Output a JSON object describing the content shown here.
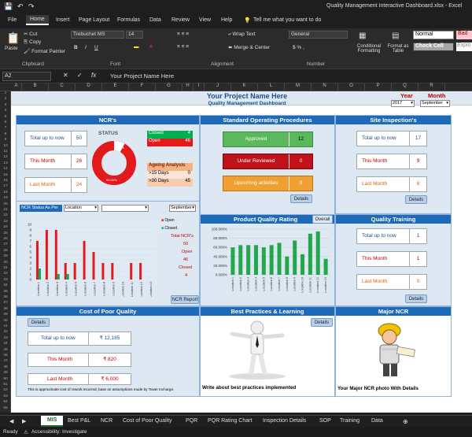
{
  "window": {
    "title": "Quality Management Interactive Dashboard.xlsx - Excel"
  },
  "menu": {
    "file": "File",
    "tabs": [
      "Home",
      "Insert",
      "Page Layout",
      "Formulas",
      "Data",
      "Review",
      "View",
      "Help"
    ],
    "tellme": "Tell me what you want to do"
  },
  "ribbon": {
    "clipboard": {
      "paste": "Paste",
      "cut": "Cut",
      "copy": "Copy",
      "painter": "Format Painter",
      "group": "Clipboard"
    },
    "font": {
      "family": "Trebuchet MS",
      "size": "14",
      "group": "Font"
    },
    "alignment": {
      "wrap": "Wrap Text",
      "merge": "Merge & Center",
      "group": "Alignment"
    },
    "number": {
      "format": "General",
      "group": "Number"
    },
    "styles": {
      "conditional": "Conditional Formatting",
      "table": "Format as Table",
      "normal": "Normal",
      "bad": "Bad",
      "check": "Check Cell",
      "expl": "Explo"
    }
  },
  "formula": {
    "namebox": "A2",
    "fx": "fx",
    "value": "Your Project Name Here"
  },
  "columns": [
    "A",
    "B",
    "C",
    "D",
    "E",
    "F",
    "G",
    "H",
    "I",
    "J",
    "K",
    "L",
    "M",
    "N",
    "O",
    "P",
    "Q",
    "R"
  ],
  "rows": [
    "1",
    "2",
    "3",
    "4",
    "5",
    "6",
    "7",
    "8",
    "9",
    "10",
    "11",
    "12",
    "13",
    "14",
    "15",
    "16",
    "17",
    "18",
    "19",
    "20",
    "21",
    "22",
    "23",
    "24",
    "25",
    "26",
    "27",
    "28",
    "29",
    "30",
    "31",
    "32",
    "33",
    "34",
    "35",
    "36",
    "37",
    "38",
    "39",
    "40",
    "41",
    "42",
    "43",
    "44",
    "45",
    "46",
    "47",
    "48",
    "49",
    "50",
    "51",
    "52",
    "53",
    "54",
    "55"
  ],
  "sheet": {
    "project": "Your Project Name Here",
    "subtitle": "Quality Management Dashboard",
    "year_label": "Year",
    "month_label": "Month",
    "year": "2017",
    "month": "September"
  },
  "ncr": {
    "title": "NCR's",
    "total_label": "Total up to now",
    "total": "50",
    "month_label": "This Month",
    "month": "26",
    "last_label": "Last Month",
    "last": "24",
    "status_title": "STATUS",
    "closed_label": "Closed",
    "closed": "4",
    "open_label": "Open",
    "open": "46",
    "donut_closed_pct": "8%",
    "donut_open_pct": "92,00%",
    "ageing_title": "Ageing Analysis",
    "gt15_label": ">15 Days",
    "gt15": "0",
    "gt30_label": ">30 Days",
    "gt30": "45",
    "filter_label": "NCR Status As Per",
    "filter_value": "Location",
    "filter2": "",
    "filter3": "September",
    "legend_open": "Open",
    "legend_closed": "Closed",
    "total_ncrs_label": "Total NCR's",
    "total_ncrs": "50",
    "open2_label": "Open",
    "open2": "46",
    "closed2_label": "Closed",
    "closed2": "4",
    "report_btn": "NCR Report"
  },
  "sop": {
    "title": "Standard Operating Procedures",
    "approved_label": "Approved",
    "approved": "12",
    "review_label": "Under Reviewed",
    "review": "0",
    "upcoming_label": "Upcoming activities",
    "upcoming": "0",
    "details": "Details"
  },
  "site": {
    "title": "Site Inspection's",
    "total_label": "Total up to now",
    "total": "17",
    "month_label": "This Month",
    "month": "9",
    "last_label": "Last Month",
    "last": "8",
    "details": "Details"
  },
  "pqr": {
    "title": "Product Quality Rating",
    "overall": "Overall"
  },
  "training": {
    "title": "Quality Training",
    "total_label": "Total up to now",
    "total": "1",
    "month_label": "This Month",
    "month": "1",
    "last_label": "Last Month",
    "last": "0",
    "details": "Details"
  },
  "copq": {
    "title": "Cost of Poor Quality",
    "details": "Details",
    "total_label": "Total up to now",
    "total": "₹ 12,185",
    "month_label": "This Month",
    "month": "₹ 820",
    "last_label": "Last Month",
    "last": "₹ 6,000",
    "note": "This is approximate cost of rework incurred, base on assumptions made by Tower Incharge."
  },
  "bp": {
    "title": "Best Practices & Learning",
    "details": "Details",
    "text": "Write about best practices implemented"
  },
  "major": {
    "title": "Major NCR",
    "text": "Your Major NCR photo With Details"
  },
  "sheet_tabs": [
    "MIS",
    "Best P&L",
    "NCR",
    "Cost of Poor Quality",
    "PQR",
    "PQR Rating Chart",
    "Inspection Details",
    "SOP",
    "Training",
    "Data"
  ],
  "status": {
    "ready": "Ready",
    "accessibility": "Accessibility: Investigate"
  },
  "colors": {
    "header_blue": "#1e6ab8",
    "red": "#c00000",
    "green": "#00b050",
    "sop_green": "#5cb85c",
    "sop_red": "#c0121b",
    "sop_orange": "#f0a030"
  },
  "chart_data": [
    {
      "type": "bar",
      "title": "",
      "xlabel": "",
      "ylabel": "",
      "ylim": [
        0,
        10
      ],
      "categories": [
        "Location 1",
        "Location 2",
        "Location 3",
        "Location 4",
        "Location 5",
        "Location 6",
        "Location 7",
        "Location 8",
        "Location 9",
        "Location 10",
        "Location 11",
        "Location 12",
        "Location 13"
      ],
      "series": [
        {
          "name": "Open",
          "values": [
            7,
            9,
            9,
            3,
            3,
            7,
            5,
            3,
            3,
            0,
            3,
            3,
            0
          ]
        },
        {
          "name": "Closed",
          "values": [
            2,
            0,
            1,
            1,
            0,
            0,
            0,
            0,
            0,
            0,
            0,
            0,
            0
          ]
        }
      ]
    },
    {
      "type": "bar",
      "title": "",
      "xlabel": "",
      "ylabel": "",
      "ylim": [
        0,
        1.0
      ],
      "categories": [
        "Location 1",
        "Location 2",
        "Location 3",
        "Location 4",
        "Location 5",
        "Location 6",
        "Location 7",
        "Location 8",
        "Location 9",
        "Location 10",
        "Location 11",
        "Location 12",
        "Location 13"
      ],
      "series": [
        {
          "name": "",
          "values": [
            0.6,
            0.65,
            0.65,
            0.65,
            0.6,
            0.65,
            0.7,
            0.4,
            0.75,
            0.45,
            0.9,
            0.95,
            0.35
          ]
        }
      ]
    },
    {
      "type": "pie",
      "title": "",
      "categories": [
        "Closed",
        "Open"
      ],
      "values": [
        8,
        92
      ]
    }
  ]
}
